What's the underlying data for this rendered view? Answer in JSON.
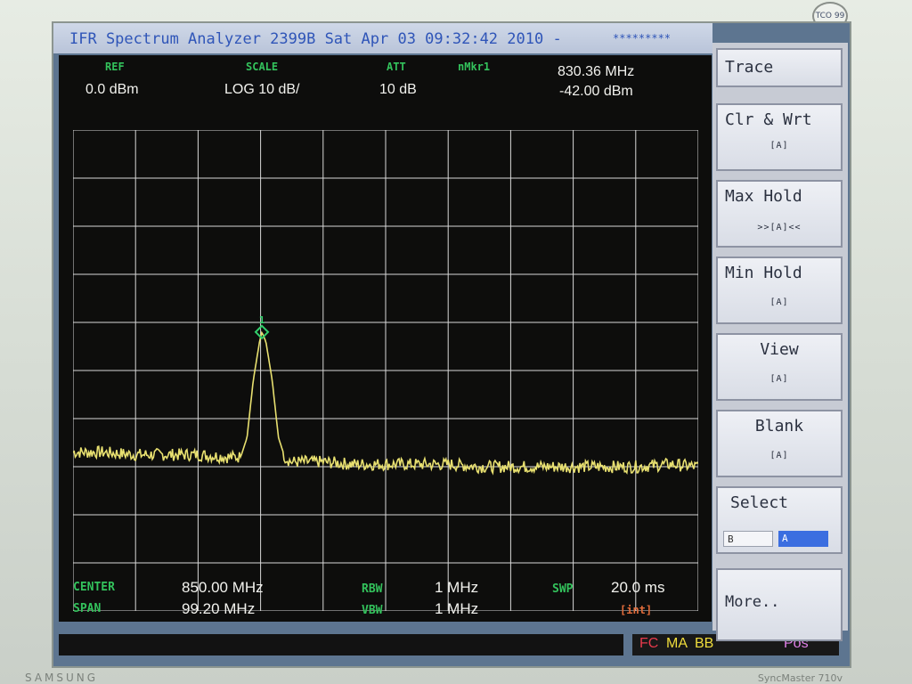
{
  "monitor": {
    "logo": "TCO 99",
    "brand": "SAMSUNG",
    "model": "SyncMaster 710v"
  },
  "titlebar": {
    "text": "IFR Spectrum Analyzer 2399B Sat Apr 03 09:32:42 2010 -",
    "stars": "*********"
  },
  "header": {
    "ref_label": "REF",
    "ref_value": "0.0 dBm",
    "scale_label": "SCALE",
    "scale_value": "LOG 10 dB/",
    "att_label": "ATT",
    "att_value": "10 dB",
    "mkr_label": "nMkr1",
    "mkr_freq": "830.36 MHz",
    "mkr_level": "-42.00 dBm"
  },
  "footer": {
    "center_label": "CENTER",
    "center_value": "850.00 MHz",
    "span_label": "SPAN",
    "span_value": "99.20 MHz",
    "rbw_label": "RBW",
    "rbw_value": "1 MHz",
    "vbw_label": "VBW",
    "vbw_value": "1 MHz",
    "swp_label": "SWP",
    "swp_value": "20.0 ms",
    "swp_mode": "[int]"
  },
  "status": {
    "fc": "FC",
    "ma": "MA",
    "bb": "BB",
    "pos": "Pos"
  },
  "softkeys": {
    "title": "Trace",
    "clr_wrt": {
      "label": "Clr & Wrt",
      "sub": "[A]"
    },
    "max_hold": {
      "label": "Max  Hold",
      "sub": ">>[A]<<"
    },
    "min_hold": {
      "label": "Min  Hold",
      "sub": "[A]"
    },
    "view": {
      "label": "View",
      "sub": "[A]"
    },
    "blank": {
      "label": "Blank",
      "sub": "[A]"
    },
    "select": {
      "label": "Select",
      "option_b": "B",
      "option_a": "A"
    },
    "more": "More.."
  },
  "chart_data": {
    "type": "line",
    "ref_level_dbm": 0,
    "scale_db_per_div": 10,
    "center_mhz": 850.0,
    "span_mhz": 99.2,
    "xlim": [
      800.4,
      899.6
    ],
    "ylim": [
      -100,
      0
    ],
    "grid": true,
    "trace_color": "#e8e070",
    "marker": {
      "label": "1",
      "x_mhz": 830.36,
      "y_dbm": -42.0
    },
    "series": [
      {
        "x": [
          800.4,
          805,
          810,
          815,
          820,
          825,
          827,
          828,
          829,
          830,
          830.36,
          831,
          832,
          833,
          834,
          835,
          840,
          845,
          850,
          855,
          860,
          865,
          870,
          875,
          880,
          885,
          890,
          895,
          899.6
        ],
        "y": [
          -67,
          -67,
          -67.5,
          -67.5,
          -67.5,
          -68,
          -68,
          -64,
          -52,
          -44,
          -42,
          -44,
          -52,
          -64,
          -68,
          -69,
          -69,
          -69.5,
          -69.5,
          -69.5,
          -69.5,
          -70,
          -70,
          -70,
          -70,
          -70,
          -70,
          -69.5,
          -70
        ]
      }
    ]
  }
}
